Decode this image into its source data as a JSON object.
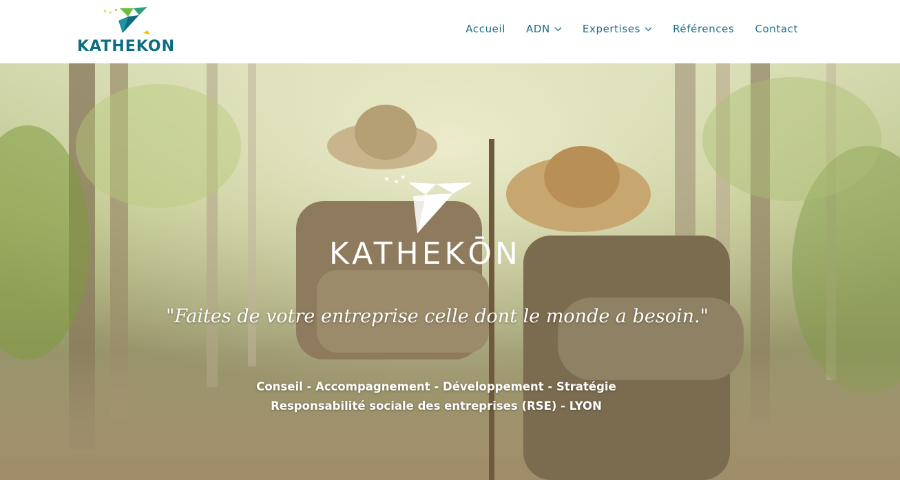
{
  "brand": {
    "name": "KATHEKON",
    "hero_name": "KATHEKŌN",
    "colors": {
      "teal": "#0c6d80",
      "green": "#6cbf3a",
      "yellow": "#f2c200",
      "nav_text": "#1b6d86"
    },
    "logo_icon": "bird-origami-icon"
  },
  "nav": {
    "items": [
      {
        "label": "Accueil",
        "has_dropdown": false
      },
      {
        "label": "ADN",
        "has_dropdown": true
      },
      {
        "label": "Expertises",
        "has_dropdown": true
      },
      {
        "label": "Références",
        "has_dropdown": false
      },
      {
        "label": "Contact",
        "has_dropdown": false
      }
    ]
  },
  "hero": {
    "background": "forest-path-children-hikers-photo",
    "tagline": "\"Faites de votre entreprise celle dont le monde a besoin.\"",
    "services_line1": "Conseil - Accompagnement - Développement - Stratégie",
    "services_line2": "Responsabilité sociale des entreprises (RSE) - LYON"
  }
}
